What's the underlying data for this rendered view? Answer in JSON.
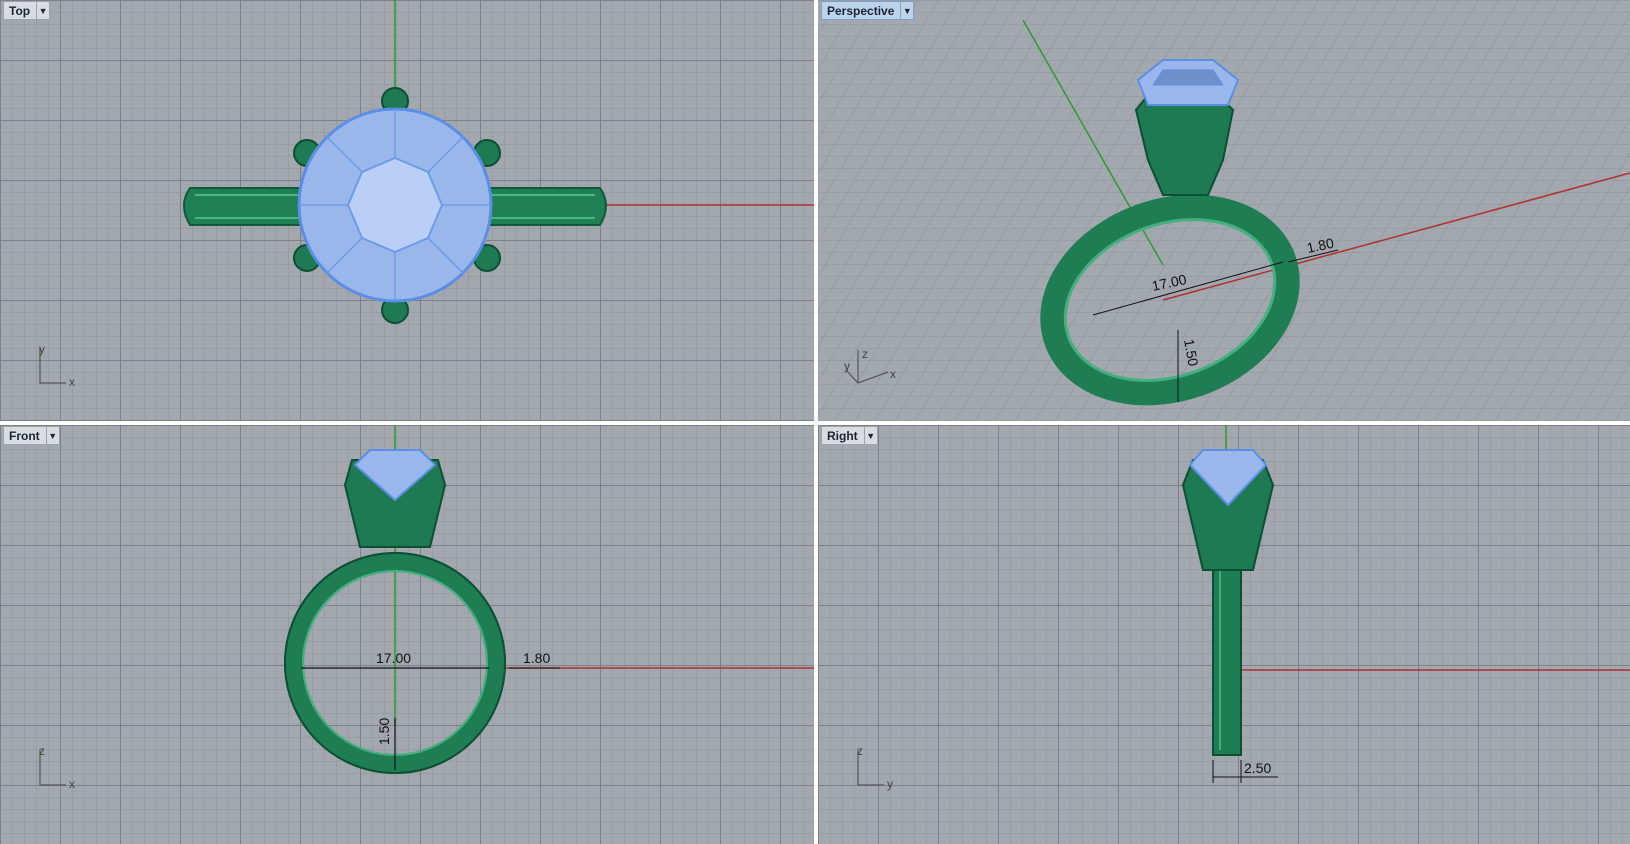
{
  "viewports": {
    "top": {
      "label": "Top",
      "axes": {
        "a": "y",
        "b": "x"
      }
    },
    "persp": {
      "label": "Perspective",
      "axes": {
        "a": "z",
        "b": "y",
        "c": "x"
      }
    },
    "front": {
      "label": "Front",
      "axes": {
        "a": "z",
        "b": "x"
      }
    },
    "right": {
      "label": "Right",
      "axes": {
        "a": "z",
        "b": "y"
      }
    }
  },
  "dimensions": {
    "diameter": "17.00",
    "band_width": "1.80",
    "band_thickness": "1.50",
    "shank_width": "2.50"
  },
  "icons": {
    "dropdown": "dropdown-arrow-icon",
    "axis": "axis-widget-icon"
  },
  "colors": {
    "viewport_bg": "#a3a7ae",
    "grid": "#787c84",
    "ring_green": "#1f8a5c",
    "gem_blue": "#a8c4f0",
    "x_axis": "#b03030",
    "y_axis": "#2f9a2f",
    "active_tab": "#bcd3ec"
  }
}
